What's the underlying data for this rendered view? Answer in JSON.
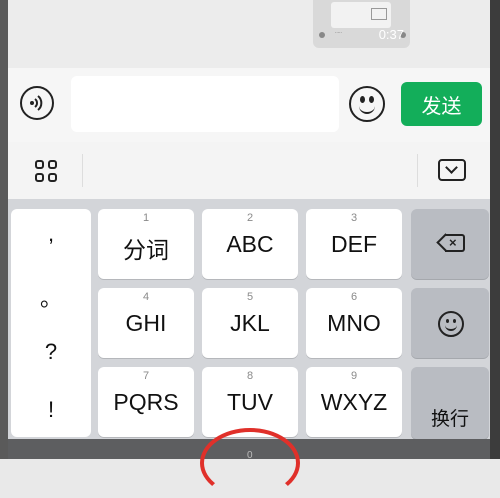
{
  "chat": {
    "video_duration": "0:37"
  },
  "input_bar": {
    "send_label": "发送",
    "input_value": ""
  },
  "keyboard": {
    "punctuation": [
      ",",
      "。",
      "?",
      "!"
    ],
    "keys": [
      {
        "num": "1",
        "label": "分词"
      },
      {
        "num": "2",
        "label": "ABC"
      },
      {
        "num": "3",
        "label": "DEF"
      },
      {
        "num": "4",
        "label": "GHI"
      },
      {
        "num": "5",
        "label": "JKL"
      },
      {
        "num": "6",
        "label": "MNO"
      },
      {
        "num": "7",
        "label": "PQRS"
      },
      {
        "num": "8",
        "label": "TUV"
      },
      {
        "num": "9",
        "label": "WXYZ"
      }
    ],
    "enter_label": "换行",
    "zero_num": "0"
  },
  "icons": {
    "voice": "voice-icon",
    "emoji": "emoji-icon",
    "grid": "grid-icon",
    "hide_keyboard": "keyboard-hide-icon",
    "backspace": "backspace-icon",
    "smiley": "smiley-icon"
  },
  "colors": {
    "send_green": "#13ae5a",
    "annotation_red": "#e0302a"
  }
}
